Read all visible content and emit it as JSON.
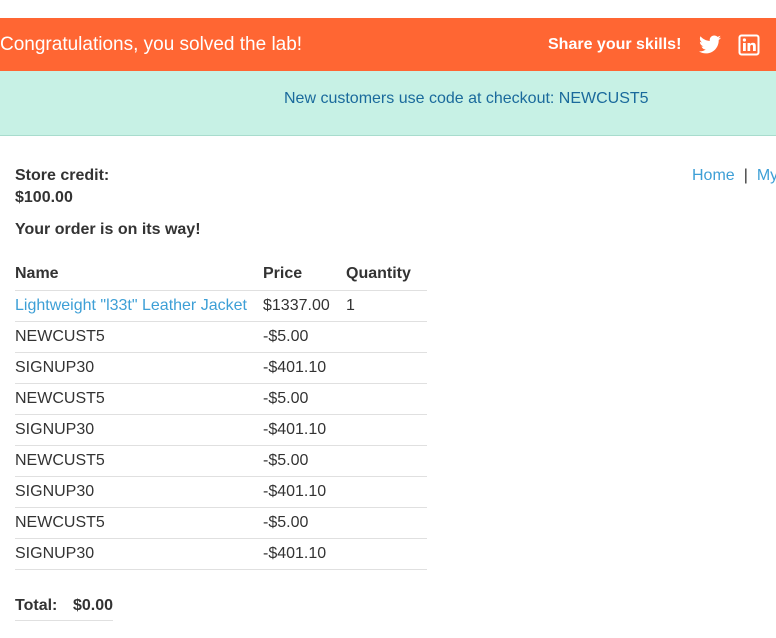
{
  "banner": {
    "message": "Congratulations, you solved the lab!",
    "share_label": "Share your skills!",
    "icons": [
      "twitter-icon",
      "linkedin-icon"
    ],
    "color": "#ff6633"
  },
  "notice": {
    "text": "New customers use code at checkout: NEWCUST5",
    "background": "#c7f1e5"
  },
  "account": {
    "credit_label": "Store credit:",
    "credit_value": "$100.00"
  },
  "nav": {
    "home": "Home",
    "separator": "|",
    "account": "My"
  },
  "order": {
    "status_message": "Your order is on its way!",
    "columns": [
      "Name",
      "Price",
      "Quantity"
    ],
    "product": {
      "name": "Lightweight \"l33t\" Leather Jacket",
      "price": "$1337.00",
      "quantity": "1"
    },
    "discounts": [
      {
        "code": "NEWCUST5",
        "amount": "-$5.00"
      },
      {
        "code": "SIGNUP30",
        "amount": "-$401.10"
      },
      {
        "code": "NEWCUST5",
        "amount": "-$5.00"
      },
      {
        "code": "SIGNUP30",
        "amount": "-$401.10"
      },
      {
        "code": "NEWCUST5",
        "amount": "-$5.00"
      },
      {
        "code": "SIGNUP30",
        "amount": "-$401.10"
      },
      {
        "code": "NEWCUST5",
        "amount": "-$5.00"
      },
      {
        "code": "SIGNUP30",
        "amount": "-$401.10"
      }
    ],
    "total_label": "Total:",
    "total_value": "$0.00"
  },
  "colors": {
    "link": "#3d9fd6",
    "text": "#333333"
  }
}
